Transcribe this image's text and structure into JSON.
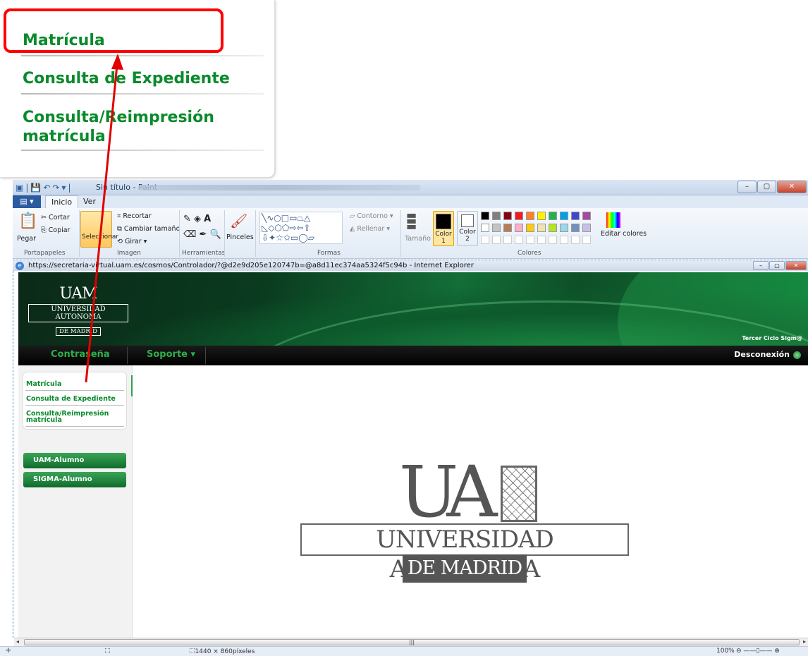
{
  "zoom": {
    "items": [
      "Matrícula",
      "Consulta de Expediente",
      "Consulta/Reimpresión",
      "matrícula"
    ]
  },
  "paint": {
    "title": "Sin título - Paint",
    "tabs": [
      "Inicio",
      "Ver"
    ],
    "clipboard": {
      "paste": "Pegar",
      "cut": "Cortar",
      "copy": "Copiar",
      "label": "Portapapeles"
    },
    "image": {
      "select": "Seleccionar",
      "crop": "Recortar",
      "resize": "Cambiar tamaño",
      "rotate": "Girar",
      "label": "Imagen"
    },
    "tools": {
      "label": "Herramientas"
    },
    "brushes": "Pinceles",
    "shapes": {
      "outline": "Contorno",
      "fill": "Rellenar",
      "label": "Formas"
    },
    "size": "Tamaño",
    "color1": "Color 1",
    "color2": "Color 2",
    "edit_colors": "Editar colores",
    "colors_label": "Colores",
    "palette": [
      "#000000",
      "#7f7f7f",
      "#880015",
      "#ed1c24",
      "#ff7f27",
      "#fff200",
      "#22b14c",
      "#00a2e8",
      "#3f48cc",
      "#a349a4",
      "#ffffff",
      "#c3c3c3",
      "#b97a57",
      "#ffaec9",
      "#ffc90e",
      "#efe4b0",
      "#b5e61d",
      "#99d9ea",
      "#7092be",
      "#c8bfe7"
    ]
  },
  "ie": {
    "title": "https://secretaria-virtual.uam.es/cosmos/Controlador/?@d2e9d205e120747b=@a8d11ec374aa5324f5c94b - Internet Explorer"
  },
  "site": {
    "logo": {
      "top": "UAM",
      "middle": "UNIVERSIDAD AUTONOMA",
      "bottom": "DE MADRID"
    },
    "tercer": "Tercer Ciclo Sigm@",
    "nav": {
      "password": "Contraseña",
      "support": "Soporte",
      "logout": "Desconexión"
    },
    "menu": [
      "Matrícula",
      "Consulta de Expediente",
      "Consulta/Reimpresión",
      "matrícula"
    ],
    "buttons": [
      "UAM-Alumno",
      "SIGMA-Alumno"
    ],
    "big_logo": {
      "ua": "UA",
      "uni": "UNIVERSIDAD AUTONOMA",
      "dm": "DE MADRID"
    }
  },
  "status": {
    "size": "1440 × 860píxeles",
    "zoom": "100%"
  },
  "colors": {
    "green_text": "#0a8a2c",
    "highlight": "#ff0000",
    "nav_bg": "#000000"
  }
}
